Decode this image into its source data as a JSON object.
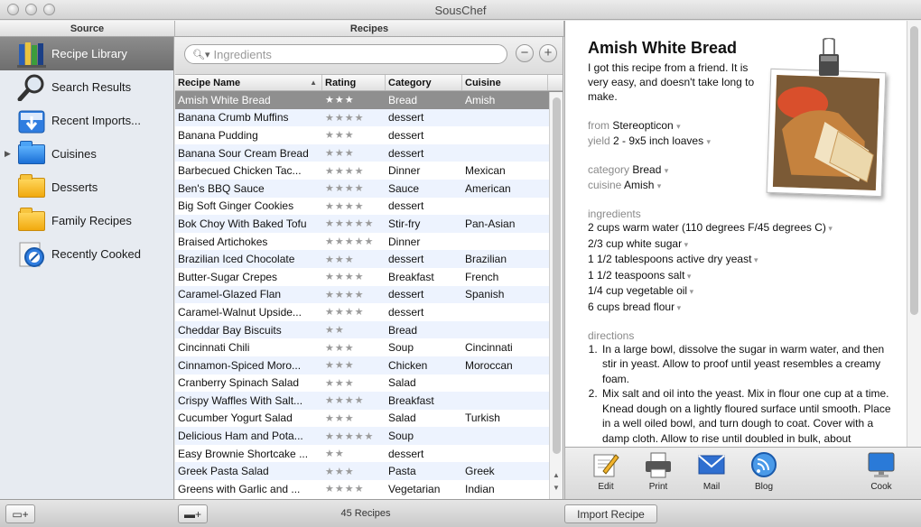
{
  "window": {
    "title": "SousChef"
  },
  "headers": {
    "source": "Source",
    "recipes": "Recipes"
  },
  "sidebar": {
    "items": [
      {
        "label": "Recipe Library",
        "icon": "books-icon",
        "selected": true
      },
      {
        "label": "Search Results",
        "icon": "magnifier-icon"
      },
      {
        "label": "Recent Imports...",
        "icon": "import-tray-icon"
      },
      {
        "label": "Cuisines",
        "icon": "blue-folder-icon",
        "expandable": true
      },
      {
        "label": "Desserts",
        "icon": "folder-icon"
      },
      {
        "label": "Family Recipes",
        "icon": "folder-icon"
      },
      {
        "label": "Recently Cooked",
        "icon": "recent-compass-icon"
      }
    ]
  },
  "search": {
    "placeholder": "Ingredients",
    "value": ""
  },
  "table": {
    "columns": [
      "Recipe Name",
      "Rating",
      "Category",
      "Cuisine"
    ],
    "rows": [
      {
        "name": "Amish White Bread",
        "rating": "★★★",
        "category": "Bread",
        "cuisine": "Amish",
        "selected": true
      },
      {
        "name": "Banana Crumb Muffins",
        "rating": "★★★★",
        "category": "dessert",
        "cuisine": ""
      },
      {
        "name": "Banana Pudding",
        "rating": "★★★",
        "category": "dessert",
        "cuisine": ""
      },
      {
        "name": "Banana Sour Cream Bread",
        "rating": "★★★",
        "category": "dessert",
        "cuisine": ""
      },
      {
        "name": "Barbecued Chicken Tac...",
        "rating": "★★★★",
        "category": "Dinner",
        "cuisine": "Mexican"
      },
      {
        "name": "Ben's BBQ Sauce",
        "rating": "★★★★",
        "category": "Sauce",
        "cuisine": "American"
      },
      {
        "name": "Big Soft Ginger Cookies",
        "rating": "★★★★",
        "category": "dessert",
        "cuisine": ""
      },
      {
        "name": "Bok Choy With Baked Tofu",
        "rating": "★★★★★",
        "category": "Stir-fry",
        "cuisine": "Pan-Asian"
      },
      {
        "name": "Braised Artichokes",
        "rating": "★★★★★",
        "category": "Dinner",
        "cuisine": ""
      },
      {
        "name": "Brazilian Iced Chocolate",
        "rating": "★★★",
        "category": "dessert",
        "cuisine": "Brazilian"
      },
      {
        "name": "Butter-Sugar Crepes",
        "rating": "★★★★",
        "category": "Breakfast",
        "cuisine": "French"
      },
      {
        "name": "Caramel-Glazed Flan",
        "rating": "★★★★",
        "category": "dessert",
        "cuisine": "Spanish"
      },
      {
        "name": "Caramel-Walnut Upside...",
        "rating": "★★★★",
        "category": "dessert",
        "cuisine": ""
      },
      {
        "name": "Cheddar Bay Biscuits",
        "rating": "★★",
        "category": "Bread",
        "cuisine": ""
      },
      {
        "name": "Cincinnati Chili",
        "rating": "★★★",
        "category": "Soup",
        "cuisine": "Cincinnati"
      },
      {
        "name": "Cinnamon-Spiced Moro...",
        "rating": "★★★",
        "category": "Chicken",
        "cuisine": "Moroccan"
      },
      {
        "name": "Cranberry Spinach Salad",
        "rating": "★★★",
        "category": "Salad",
        "cuisine": ""
      },
      {
        "name": "Crispy Waffles With Salt...",
        "rating": "★★★★",
        "category": "Breakfast",
        "cuisine": ""
      },
      {
        "name": "Cucumber Yogurt Salad",
        "rating": "★★★",
        "category": "Salad",
        "cuisine": "Turkish"
      },
      {
        "name": "Delicious Ham and Pota...",
        "rating": "★★★★★",
        "category": "Soup",
        "cuisine": ""
      },
      {
        "name": "Easy Brownie Shortcake ...",
        "rating": "★★",
        "category": "dessert",
        "cuisine": ""
      },
      {
        "name": "Greek Pasta Salad",
        "rating": "★★★",
        "category": "Pasta",
        "cuisine": "Greek"
      },
      {
        "name": "Greens with Garlic and ...",
        "rating": "★★★★",
        "category": "Vegetarian",
        "cuisine": "Indian"
      }
    ]
  },
  "detail": {
    "title": "Amish White Bread",
    "description": "I got this recipe from a friend. It is very easy, and doesn't take long to make.",
    "from_label": "from",
    "from_value": "Stereopticon",
    "yield_label": "yield",
    "yield_value": "2 - 9x5 inch loaves",
    "category_label": "category",
    "category_value": "Bread",
    "cuisine_label": "cuisine",
    "cuisine_value": "Amish",
    "ingredients_label": "ingredients",
    "ingredients": [
      "2 cups warm water (110 degrees F/45 degrees C)",
      "2/3 cup white sugar",
      "1 1/2 tablespoons active dry yeast",
      "1 1/2 teaspoons salt",
      "1/4 cup vegetable oil",
      "6 cups bread flour"
    ],
    "directions_label": "directions",
    "directions": [
      "In a large bowl, dissolve the sugar in warm water, and then stir in yeast. Allow to proof until yeast resembles a creamy foam.",
      "Mix salt and oil into the yeast. Mix in flour one cup at a time. Knead dough on a lightly floured surface until smooth. Place in a well oiled bowl, and turn dough to coat. Cover with a damp cloth. Allow to rise until doubled in bulk, about"
    ]
  },
  "toolbar": {
    "edit": "Edit",
    "print": "Print",
    "mail": "Mail",
    "blog": "Blog",
    "cook": "Cook"
  },
  "footer": {
    "count": "45 Recipes",
    "import_button": "Import Recipe"
  },
  "colors": {
    "selection": "#8f8f8f",
    "stripe": "#edf3fe",
    "source_bg": "#e7ebf1"
  }
}
